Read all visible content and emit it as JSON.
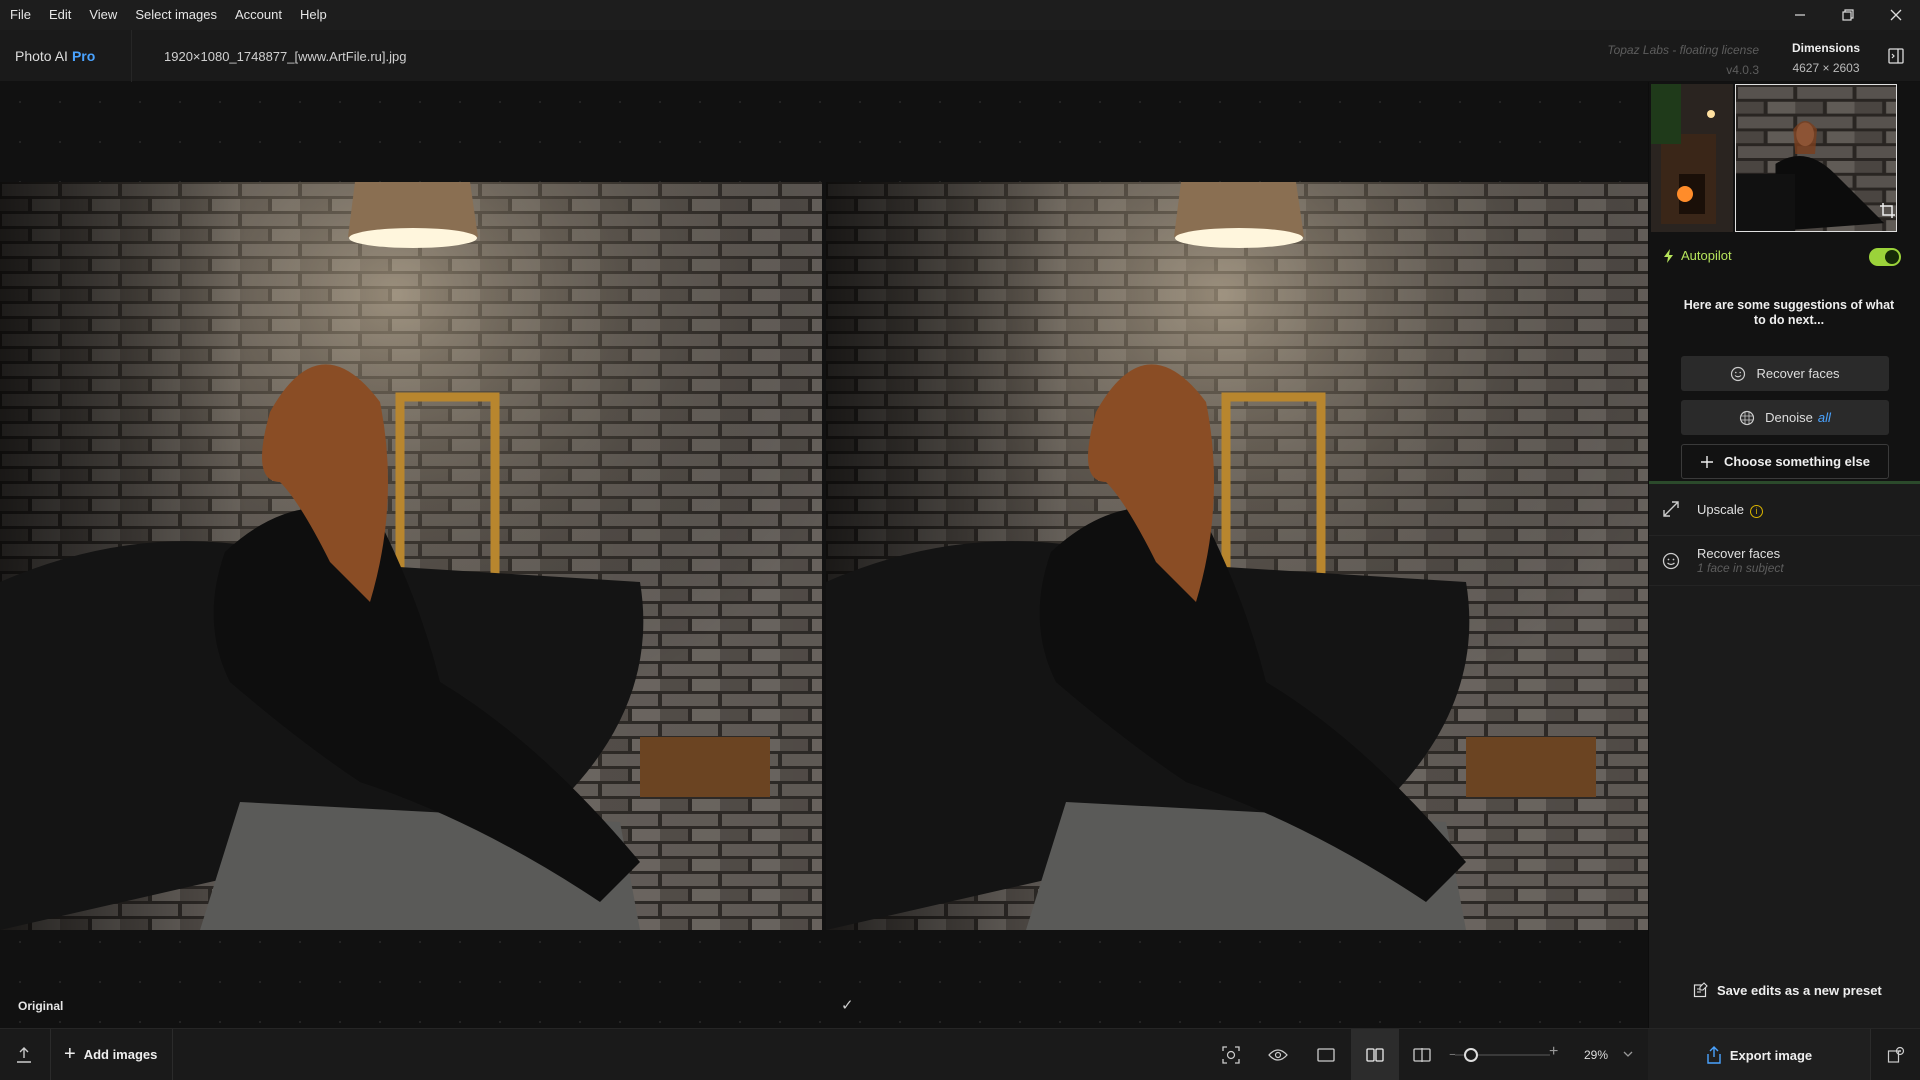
{
  "menu": {
    "items": [
      "File",
      "Edit",
      "View",
      "Select images",
      "Account",
      "Help"
    ]
  },
  "window": {
    "minimize_icon": "minimize-icon",
    "restore_icon": "restore-icon",
    "close_icon": "close-icon"
  },
  "header": {
    "app_name": "Photo AI",
    "app_tier": "Pro",
    "filename": "1920×1080_1748877_[www.ArtFile.ru].jpg",
    "license_text": "Topaz Labs - floating license",
    "version": "v4.0.3",
    "dimensions_title": "Dimensions",
    "dimensions_value": "4627 × 2603"
  },
  "canvas": {
    "left_label": "Original",
    "right_label_icon": "✓"
  },
  "panel": {
    "autopilot_label": "Autopilot",
    "autopilot_enabled": true,
    "suggestion_text": "Here are some suggestions of what to do next...",
    "suggestions": {
      "recover_faces": "Recover faces",
      "denoise": "Denoise",
      "denoise_tag": "all",
      "choose_else": "Choose something else"
    },
    "tools": {
      "upscale_title": "Upscale",
      "upscale_info": "i",
      "recover_title": "Recover faces",
      "recover_sub": "1 face in subject"
    },
    "save_preset": "Save edits as a new preset"
  },
  "bottombar": {
    "add_images": "Add images",
    "zoom_minus": "−",
    "zoom_plus": "+",
    "zoom_value": "29%",
    "export": "Export image"
  },
  "colors": {
    "accent_blue": "#4aa3ff",
    "autopilot_green": "#9bd33a",
    "warning_yellow": "#d9b400"
  }
}
